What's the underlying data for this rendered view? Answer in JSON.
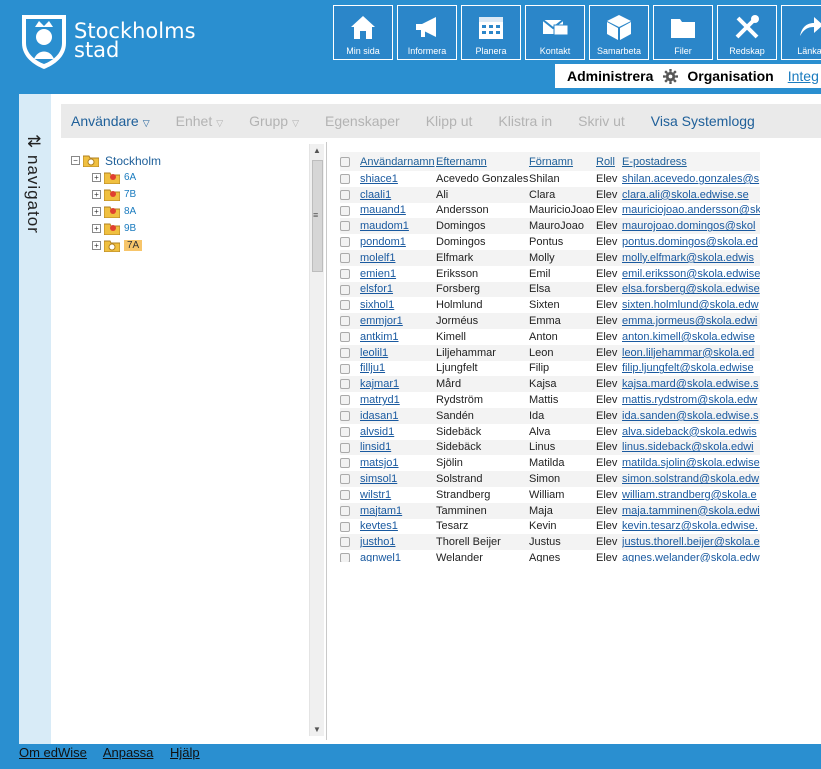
{
  "brand": {
    "line1": "Stockholms",
    "line2": "stad"
  },
  "topnav": [
    {
      "label": "Min sida",
      "icon": "home-icon"
    },
    {
      "label": "Informera",
      "icon": "megaphone-icon"
    },
    {
      "label": "Planera",
      "icon": "calendar-icon"
    },
    {
      "label": "Kontakt",
      "icon": "mail-icon"
    },
    {
      "label": "Samarbeta",
      "icon": "cube-icon"
    },
    {
      "label": "Filer",
      "icon": "folder-icon"
    },
    {
      "label": "Redskap",
      "icon": "tools-icon"
    },
    {
      "label": "Länkar",
      "icon": "share-arrow-icon"
    }
  ],
  "adminbar": {
    "administrera": "Administrera",
    "organisation": "Organisation",
    "integ": "Integ"
  },
  "navigator": {
    "label": "navigator",
    "arrows": "⇅"
  },
  "toolbar": {
    "anvandare": "Användare",
    "enhet": "Enhet",
    "grupp": "Grupp",
    "egenskaper": "Egenskaper",
    "klipp_ut": "Klipp ut",
    "klistra_in": "Klistra in",
    "skriv_ut": "Skriv ut",
    "visa_systemlogg": "Visa Systemlogg"
  },
  "tree": {
    "root": "Stockholm",
    "children": [
      "6A",
      "7B",
      "8A",
      "9B",
      "7A"
    ],
    "selected": "7A"
  },
  "table": {
    "headers": [
      "Användarnamn",
      "Efternamn",
      "Förnamn",
      "Roll",
      "E-postadress"
    ],
    "rows": [
      [
        "shiace1",
        "Acevedo Gonzales",
        "Shilan",
        "Elev",
        "shilan.acevedo.gonzales@s"
      ],
      [
        "claali1",
        "Ali",
        "Clara",
        "Elev",
        "clara.ali@skola.edwise.se"
      ],
      [
        "mauand1",
        "Andersson",
        "MauricioJoao",
        "Elev",
        "mauriciojoao.andersson@sk"
      ],
      [
        "maudom1",
        "Domingos",
        "MauroJoao",
        "Elev",
        "maurojoao.domingos@skol"
      ],
      [
        "pondom1",
        "Domingos",
        "Pontus",
        "Elev",
        "pontus.domingos@skola.ed"
      ],
      [
        "molelf1",
        "Elfmark",
        "Molly",
        "Elev",
        "molly.elfmark@skola.edwis"
      ],
      [
        "emien1",
        "Eriksson",
        "Emil",
        "Elev",
        "emil.eriksson@skola.edwise"
      ],
      [
        "elsfor1",
        "Forsberg",
        "Elsa",
        "Elev",
        "elsa.forsberg@skola.edwise"
      ],
      [
        "sixhol1",
        "Holmlund",
        "Sixten",
        "Elev",
        "sixten.holmlund@skola.edw"
      ],
      [
        "emmjor1",
        "Jorméus",
        "Emma",
        "Elev",
        "emma.jormeus@skola.edwi"
      ],
      [
        "antkim1",
        "Kimell",
        "Anton",
        "Elev",
        "anton.kimell@skola.edwise"
      ],
      [
        "leolil1",
        "Liljehammar",
        "Leon",
        "Elev",
        "leon.liljehammar@skola.ed"
      ],
      [
        "fillju1",
        "Ljungfelt",
        "Filip",
        "Elev",
        "filip.ljungfelt@skola.edwise"
      ],
      [
        "kajmar1",
        "Mård",
        "Kajsa",
        "Elev",
        "kajsa.mard@skola.edwise.s"
      ],
      [
        "matryd1",
        "Rydström",
        "Mattis",
        "Elev",
        "mattis.rydstrom@skola.edw"
      ],
      [
        "idasan1",
        "Sandén",
        "Ida",
        "Elev",
        "ida.sanden@skola.edwise.s"
      ],
      [
        "alvsid1",
        "Sidebäck",
        "Alva",
        "Elev",
        "alva.sideback@skola.edwis"
      ],
      [
        "linsid1",
        "Sidebäck",
        "Linus",
        "Elev",
        "linus.sideback@skola.edwi"
      ],
      [
        "matsjo1",
        "Sjölin",
        "Matilda",
        "Elev",
        "matilda.sjolin@skola.edwise"
      ],
      [
        "simsol1",
        "Solstrand",
        "Simon",
        "Elev",
        "simon.solstrand@skola.edw"
      ],
      [
        "wilstr1",
        "Strandberg",
        "William",
        "Elev",
        "william.strandberg@skola.e"
      ],
      [
        "majtam1",
        "Tamminen",
        "Maja",
        "Elev",
        "maja.tamminen@skola.edwi"
      ],
      [
        "kevtes1",
        "Tesarz",
        "Kevin",
        "Elev",
        "kevin.tesarz@skola.edwise."
      ],
      [
        "justho1",
        "Thorell Beijer",
        "Justus",
        "Elev",
        "justus.thorell.beijer@skola.e"
      ],
      [
        "agnwel1",
        "Welander",
        "Agnes",
        "Elev",
        "agnes.welander@skola.edw"
      ]
    ]
  },
  "footer": [
    "Om edWise",
    "Anpassa",
    "Hjälp"
  ],
  "colors": {
    "header_bg": "#2a8fd0",
    "toolbar_active": "#1e5f99",
    "toolbar_disabled": "#b3b3b3",
    "selected_node": "#f7c56a"
  }
}
